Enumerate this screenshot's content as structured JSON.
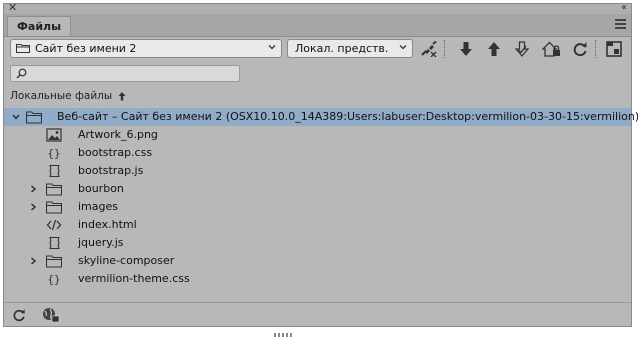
{
  "panel": {
    "tab_label": "Файлы",
    "close_glyph": "✕",
    "collapse_glyph": "‹‹"
  },
  "toolbar": {
    "site_select_value": "Сайт без имени 2",
    "view_select_value": "Локал. предств.",
    "buttons": [
      "disconnect-icon",
      "get-files-icon",
      "put-files-icon",
      "check-out-icon",
      "check-in-icon",
      "refresh-icon",
      "expand-view-icon"
    ]
  },
  "search": {
    "value": "",
    "placeholder": ""
  },
  "file_list": {
    "column_header": "Локальные файлы",
    "root": "Веб-сайт – Сайт без имени 2 (OSX10.10.0_14A389:Users:labuser:Desktop:vermilion-03-30-15:vermilion)",
    "items": [
      {
        "name": "Artwork_6.png",
        "type": "image",
        "expandable": false
      },
      {
        "name": "bootstrap.css",
        "type": "css",
        "expandable": false
      },
      {
        "name": "bootstrap.js",
        "type": "js",
        "expandable": false
      },
      {
        "name": "bourbon",
        "type": "folder",
        "expandable": true
      },
      {
        "name": "images",
        "type": "folder",
        "expandable": true
      },
      {
        "name": "index.html",
        "type": "html",
        "expandable": false
      },
      {
        "name": "jquery.js",
        "type": "js",
        "expandable": false
      },
      {
        "name": "skyline-composer",
        "type": "folder",
        "expandable": true
      },
      {
        "name": "vermilion-theme.css",
        "type": "css",
        "expandable": false
      }
    ]
  },
  "colors": {
    "panel_bg": "#b8b8b8",
    "selection": "#91abc9",
    "icon": "#333333"
  }
}
